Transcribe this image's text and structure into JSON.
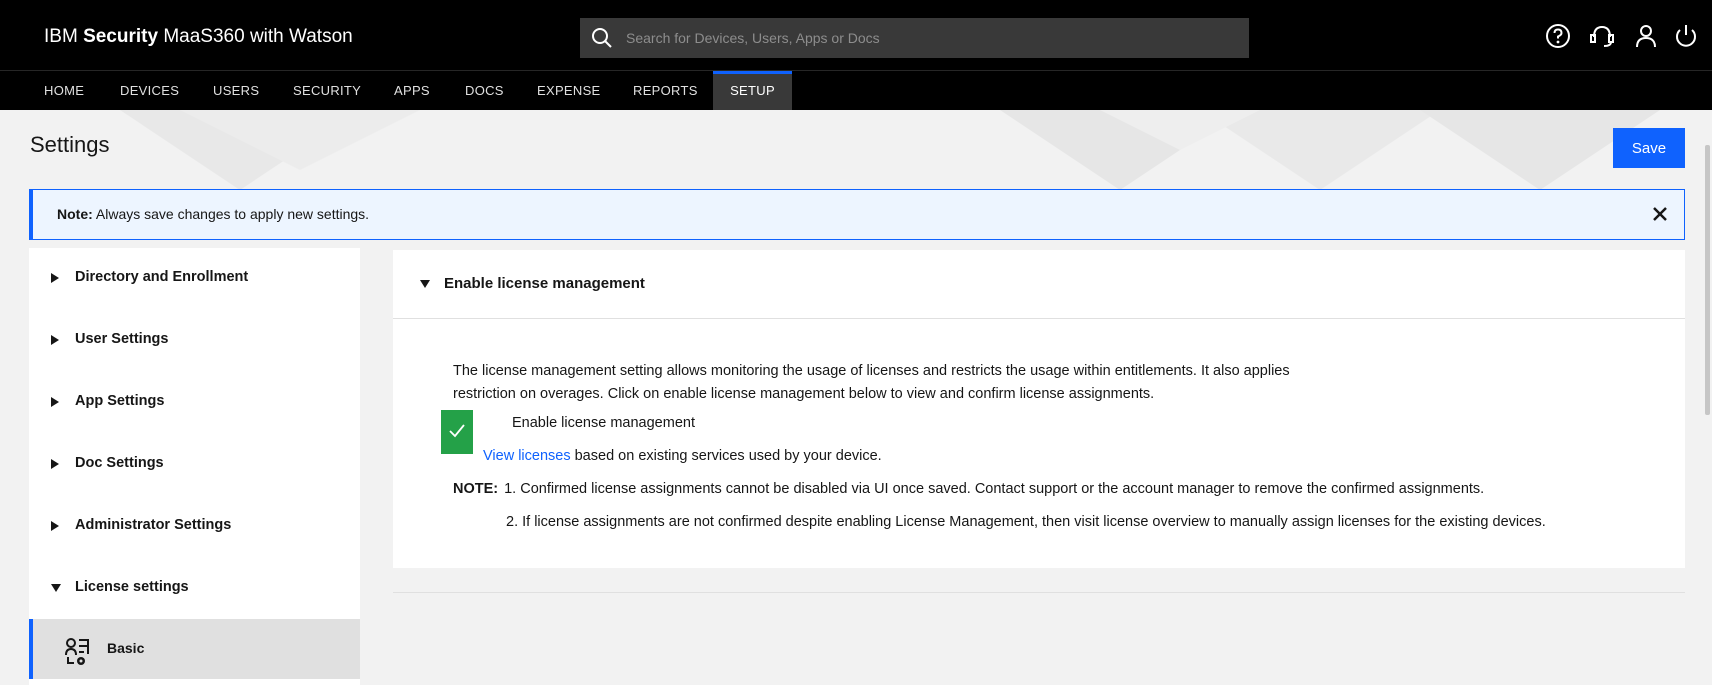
{
  "header": {
    "brand_prefix": "IBM ",
    "brand_bold": "Security",
    "brand_suffix": " MaaS360 with Watson",
    "search_placeholder": "Search for Devices, Users, Apps or Docs",
    "icons": [
      "help-icon",
      "support-headset-icon",
      "user-icon",
      "power-icon"
    ]
  },
  "nav": {
    "items": [
      {
        "label": "HOME"
      },
      {
        "label": "DEVICES"
      },
      {
        "label": "USERS"
      },
      {
        "label": "SECURITY"
      },
      {
        "label": "APPS"
      },
      {
        "label": "DOCS"
      },
      {
        "label": "EXPENSE"
      },
      {
        "label": "REPORTS"
      },
      {
        "label": "SETUP",
        "active": true
      }
    ]
  },
  "page": {
    "title": "Settings",
    "save_label": "Save"
  },
  "notification": {
    "bold": "Note:",
    "text": " Always save changes to apply new settings."
  },
  "sidebar": {
    "items": [
      {
        "label": "Directory and Enrollment",
        "expanded": false
      },
      {
        "label": "User Settings",
        "expanded": false
      },
      {
        "label": "App Settings",
        "expanded": false
      },
      {
        "label": "Doc Settings",
        "expanded": false
      },
      {
        "label": "Administrator Settings",
        "expanded": false
      },
      {
        "label": "License settings",
        "expanded": true
      }
    ],
    "sub_item": {
      "label": "Basic",
      "selected": true
    }
  },
  "main": {
    "section_title": "Enable license management",
    "description_line1": "The license management setting allows monitoring the usage of licenses and restricts the usage within entitlements. It also applies",
    "description_line2": "restriction on overages. Click on enable license management below to view and confirm license assignments.",
    "checkbox_label": "Enable license management",
    "checkbox_checked": true,
    "link_text": "View licenses",
    "link_suffix": " based on existing services used by your device.",
    "note_label": "NOTE:",
    "note1": "1. Confirmed license assignments cannot be disabled via UI once saved. Contact support or the account manager to remove the confirmed assignments.",
    "note2": "2. If license assignments are not confirmed despite enabling License Management, then visit license overview to manually assign licenses for the existing devices."
  },
  "colors": {
    "accent": "#0f62fe",
    "success": "#24a148",
    "header_bg": "#000000"
  }
}
